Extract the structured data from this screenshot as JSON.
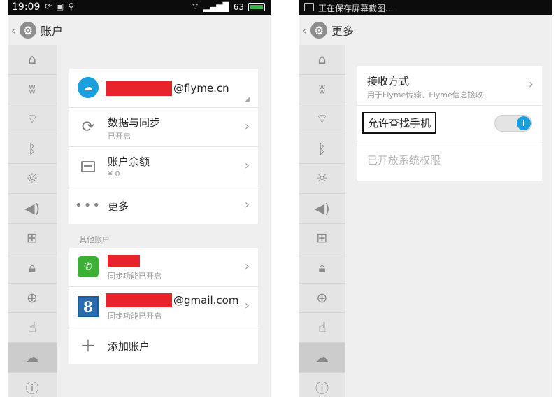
{
  "left_screen": {
    "status": {
      "time": "19:09",
      "battery": "63"
    },
    "title": "账户",
    "primary_account": {
      "email_suffix": "@flyme.cn"
    },
    "rows": [
      {
        "title": "数据与同步",
        "subtitle": "已开启"
      },
      {
        "title": "账户余额",
        "subtitle": "¥ 0"
      },
      {
        "title": "更多"
      }
    ],
    "section_label": "其他账户",
    "other_accounts": [
      {
        "name": "",
        "subtitle": "同步功能已开启"
      },
      {
        "email_suffix": "@gmail.com",
        "subtitle": "同步功能已开启",
        "badge": "8"
      }
    ],
    "add_account": "添加账户"
  },
  "right_screen": {
    "status": {
      "capture_text": "正在保存屏幕截图..."
    },
    "title": "更多",
    "receive_method": {
      "title": "接收方式",
      "subtitle": "用于Flyme传输、Flyme信息接收"
    },
    "find_phone": {
      "label": "允许查找手机",
      "enabled": true
    },
    "granted_permissions": "已开放系统权限"
  },
  "icons": {
    "sidebar": [
      "shirt-icon",
      "antenna-icon",
      "wifi-icon",
      "bluetooth-icon",
      "brightness-icon",
      "volume-icon",
      "apps-grid-icon",
      "lock-location-icon",
      "globe-icon",
      "hand-icon",
      "cloud-icon",
      "info-icon"
    ],
    "sidebar_active": "cloud-icon"
  },
  "colors": {
    "accent": "#1aa0df",
    "redaction": "#e8232b",
    "wechat": "#3cb035"
  }
}
